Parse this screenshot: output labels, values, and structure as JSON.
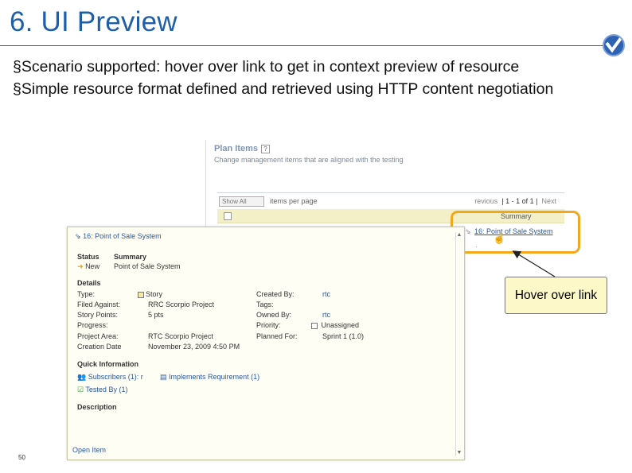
{
  "slide": {
    "title": "6. UI Preview",
    "bullets": [
      "Scenario supported: hover over link to get in context preview of resource",
      "Simple resource format defined and retrieved using HTTP content negotiation"
    ],
    "bullet_mark": "§",
    "page_number": "50",
    "callout": "Hover over link"
  },
  "panel": {
    "heading": "Plan Items",
    "help": "?",
    "subtitle": "Change management items that are aligned with the testing",
    "show_all": "Show All",
    "items_per_page": "items per page",
    "pager_prev": "revious",
    "pager_range": "| 1 - 1 of 1 |",
    "pager_next": "Next",
    "col_summary": "Summary",
    "link_text": "16: Point of Sale System"
  },
  "popup": {
    "title": "16: Point of Sale System",
    "status_label": "Status",
    "summary_label": "Summary",
    "status_value": "New",
    "summary_value": "Point of Sale System",
    "details_label": "Details",
    "left_fields": [
      {
        "label": "Type:",
        "value": "Story"
      },
      {
        "label": "Filed Against:",
        "value": "RRC Scorpio Project"
      },
      {
        "label": "Story Points:",
        "value": "5 pts"
      },
      {
        "label": "Progress:",
        "value": ""
      },
      {
        "label": "Project Area:",
        "value": "RTC Scorpio Project"
      },
      {
        "label": "Creation Date",
        "value": "November 23, 2009 4:50 PM"
      }
    ],
    "right_fields": [
      {
        "label": "Created By:",
        "value": "rtc"
      },
      {
        "label": "Tags:",
        "value": ""
      },
      {
        "label": "Owned By:",
        "value": "rtc"
      },
      {
        "label": "Priority:",
        "value": "Unassigned"
      },
      {
        "label": "Planned For:",
        "value": "Sprint 1 (1.0)"
      }
    ],
    "quick_info_label": "Quick Information",
    "subscribers": "Subscribers (1): r",
    "implements": "Implements Requirement (1)",
    "tested_by": "Tested By (1)",
    "description_label": "Description",
    "open_item": "Open Item"
  }
}
